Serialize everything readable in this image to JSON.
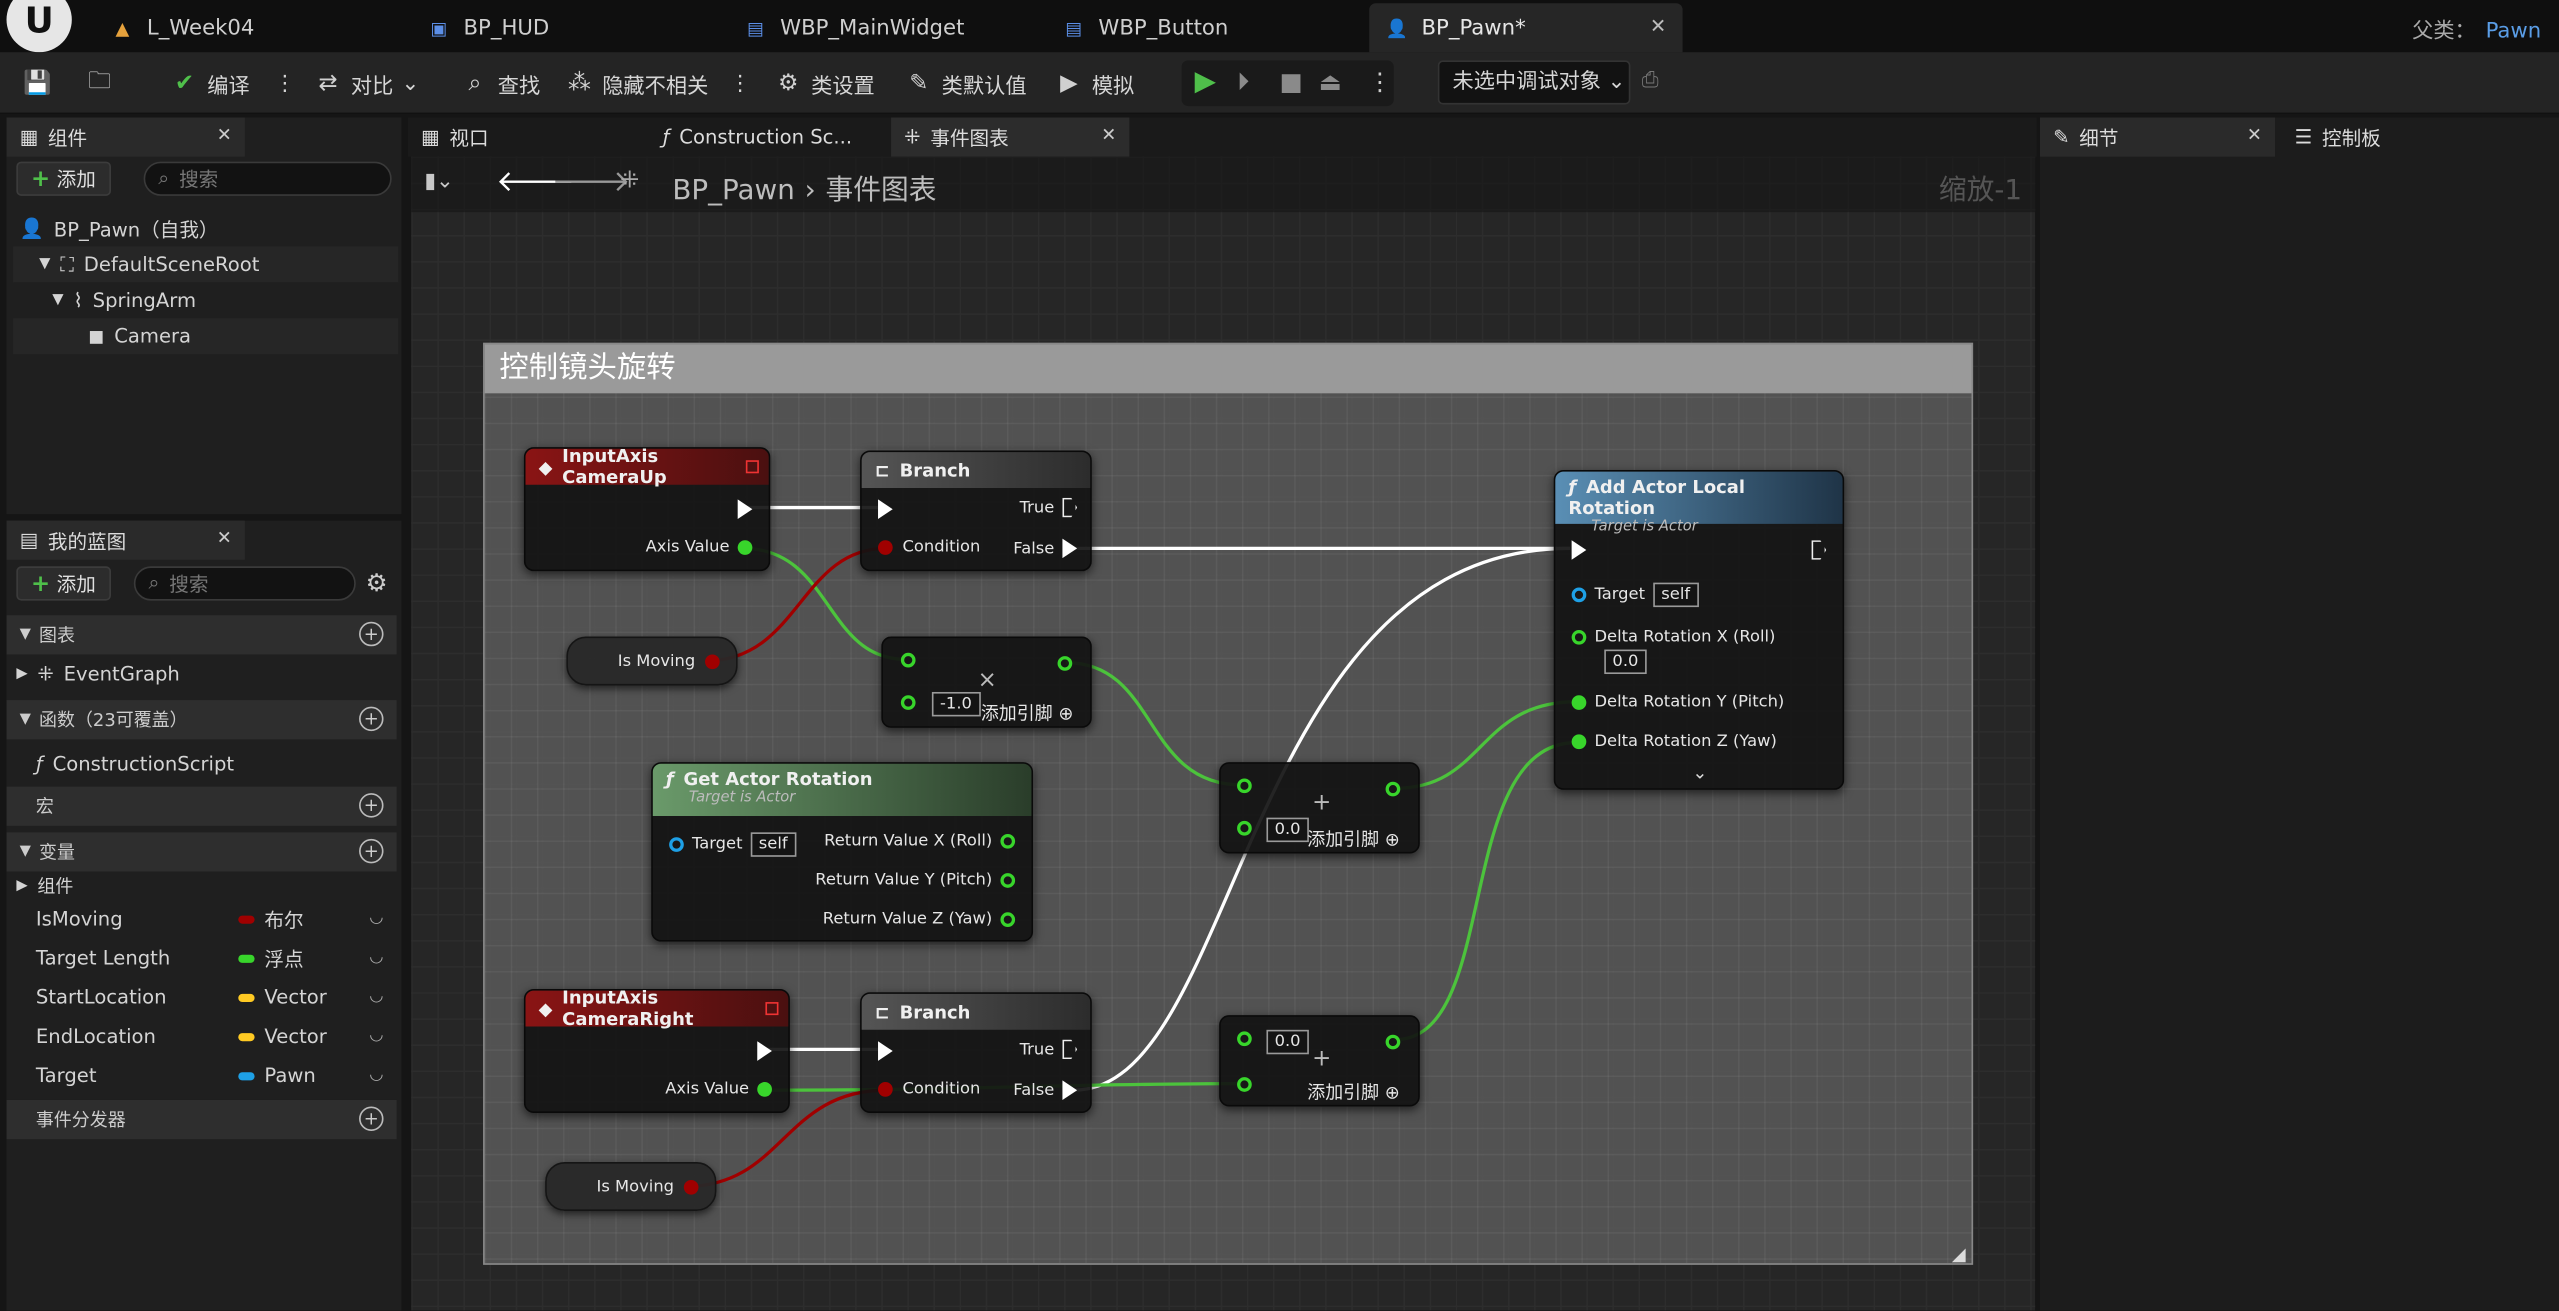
{
  "tabs": [
    {
      "label": "L_Week04",
      "icon": "level-icon",
      "color": "#e6a23c"
    },
    {
      "label": "BP_HUD",
      "icon": "hud-blueprint-icon",
      "color": "#5b8ee6"
    },
    {
      "label": "WBP_MainWidget",
      "icon": "widget-blueprint-icon",
      "color": "#5b8ee6"
    },
    {
      "label": "WBP_Button",
      "icon": "widget-blueprint-icon",
      "color": "#5b8ee6"
    },
    {
      "label": "BP_Pawn*",
      "icon": "pawn-blueprint-icon",
      "color": "#5b8ee6"
    }
  ],
  "parent": {
    "label": "父类：",
    "value": "Pawn"
  },
  "toolbar": {
    "compile": "编译",
    "diff": "对比",
    "find": "查找",
    "hide_unrelated": "隐藏不相关",
    "class_settings": "类设置",
    "class_defaults": "类默认值",
    "simulate": "模拟",
    "debug_target": "未选中调试对象"
  },
  "components_panel": {
    "title": "组件",
    "add": "添加",
    "search_placeholder": "搜索",
    "root": "BP_Pawn（自我）",
    "items": [
      "DefaultSceneRoot",
      "SpringArm",
      "Camera"
    ]
  },
  "viewport_tabs": [
    "视口",
    "Construction Sc...",
    "事件图表"
  ],
  "breadcrumb": {
    "blueprint": "BP_Pawn",
    "graph": "事件图表",
    "zoom": "缩放-1"
  },
  "my_blueprint": {
    "title": "我的蓝图",
    "add": "添加",
    "search_placeholder": "搜索",
    "graphs_label": "图表",
    "event_graph": "EventGraph",
    "functions_label": "函数（23可覆盖）",
    "construction_script": "ConstructionScript",
    "macros_label": "宏",
    "variables_label": "变量",
    "components_label": "组件",
    "variables": [
      {
        "name": "IsMoving",
        "type": "布尔",
        "color": "#a00000"
      },
      {
        "name": "Target Length",
        "type": "浮点",
        "color": "#38d52b"
      },
      {
        "name": "StartLocation",
        "type": "Vector",
        "color": "#ffca23"
      },
      {
        "name": "EndLocation",
        "type": "Vector",
        "color": "#ffca23"
      },
      {
        "name": "Target",
        "type": "Pawn",
        "color": "#1ea0e6"
      }
    ],
    "event_dispatchers_label": "事件分发器"
  },
  "right_panel": {
    "details": "细节",
    "control": "控制板"
  },
  "graph": {
    "comment": "控制镜头旋转",
    "input_up": {
      "title": "InputAxis CameraUp",
      "axis": "Axis Value"
    },
    "branch1": {
      "title": "Branch",
      "true": "True",
      "false": "False",
      "condition": "Condition"
    },
    "is_moving1": "Is Moving",
    "multiply": {
      "value": "-1.0",
      "add_pin": "添加引脚"
    },
    "get_rot": {
      "title": "Get Actor Rotation",
      "sub": "Target is Actor",
      "target": "Target",
      "self": "self",
      "x": "Return Value X (Roll)",
      "y": "Return Value Y (Pitch)",
      "z": "Return Value Z (Yaw)"
    },
    "add1": {
      "value": "0.0",
      "add_pin": "添加引脚"
    },
    "add_rot": {
      "title": "Add Actor Local Rotation",
      "sub": "Target is Actor",
      "target": "Target",
      "self": "self",
      "x": "Delta Rotation X (Roll)",
      "xval": "0.0",
      "y": "Delta Rotation Y (Pitch)",
      "z": "Delta Rotation Z (Yaw)"
    },
    "input_right": {
      "title": "InputAxis CameraRight",
      "axis": "Axis Value"
    },
    "branch2": {
      "title": "Branch",
      "true": "True",
      "false": "False",
      "condition": "Condition"
    },
    "add2": {
      "value": "0.0",
      "add_pin": "添加引脚"
    },
    "is_moving2": "Is Moving"
  }
}
